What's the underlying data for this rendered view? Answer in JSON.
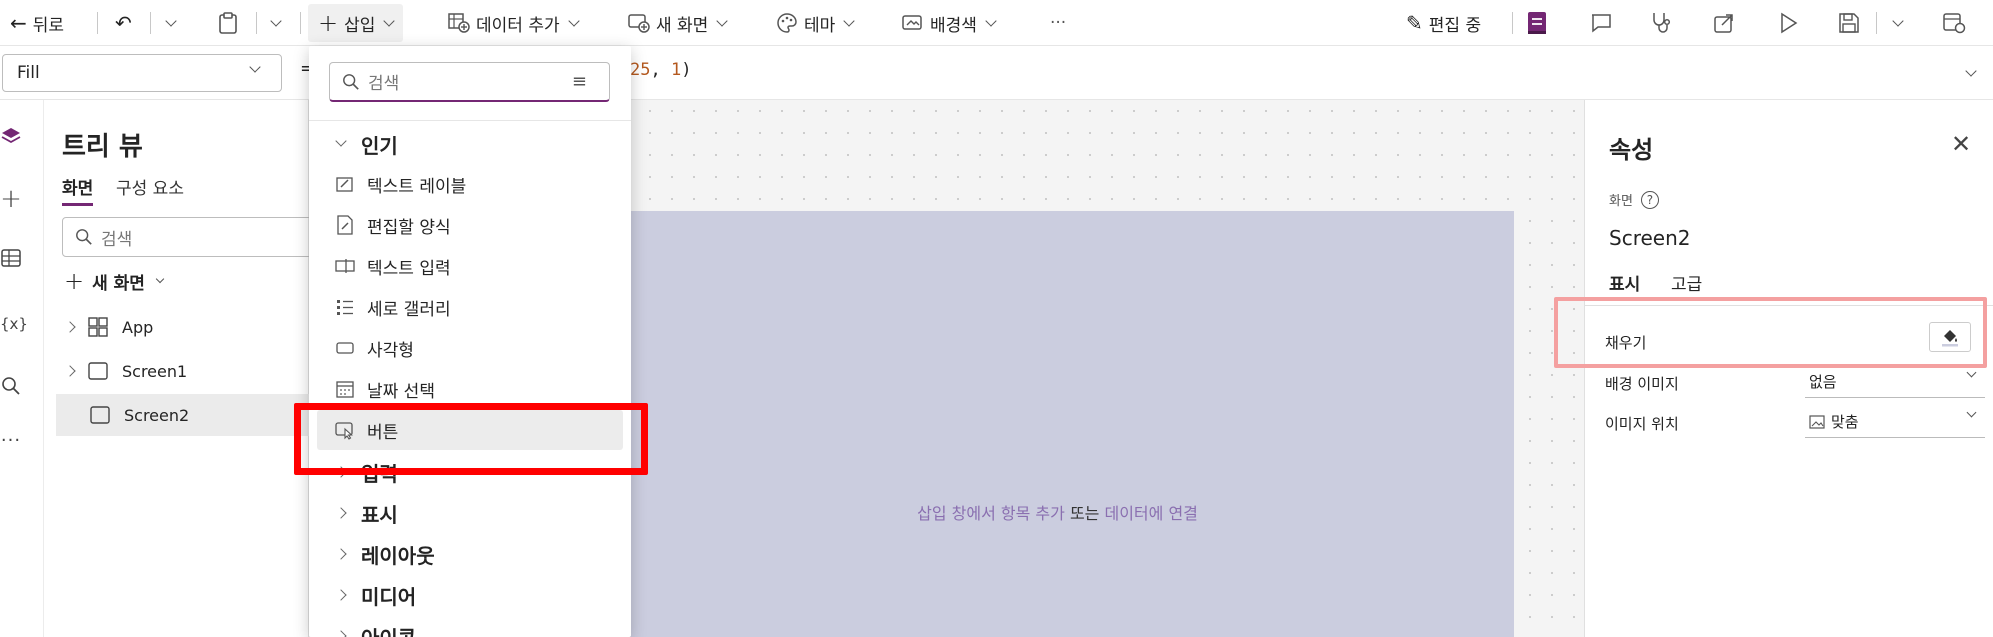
{
  "toolbar": {
    "back_label": "뒤로",
    "insert_label": "삽입",
    "add_data_label": "데이터 추가",
    "new_screen_label": "새 화면",
    "theme_label": "테마",
    "background_label": "배경색",
    "more_label": "···",
    "editing_label": "편집 중"
  },
  "formula": {
    "property": "Fill",
    "equals": "=",
    "tail_num": "25",
    "tail_sep": ", ",
    "tail_num2": "1",
    "tail_close": ")"
  },
  "tree": {
    "title": "트리 뷰",
    "tabs": [
      "화면",
      "구성 요소"
    ],
    "search_placeholder": "검색",
    "new_screen": "새 화면",
    "items": [
      "App",
      "Screen1",
      "Screen2"
    ]
  },
  "insert": {
    "search_placeholder": "검색",
    "popular_label": "인기",
    "items": [
      "텍스트 레이블",
      "편집할 양식",
      "텍스트 입력",
      "세로 갤러리",
      "사각형",
      "날짜 선택",
      "버튼"
    ],
    "categories": [
      "입력",
      "표시",
      "레이아웃",
      "미디어",
      "아이콘"
    ]
  },
  "canvas": {
    "hint_link1": "삽입 창에서 항목 추가",
    "hint_plain": " 또는 ",
    "hint_link2": "데이터에 연결"
  },
  "properties": {
    "title": "속성",
    "scope_label": "화면",
    "screen_name": "Screen2",
    "tabs": [
      "표시",
      "고급"
    ],
    "fill_label": "채우기",
    "bg_image_label": "배경 이미지",
    "bg_image_value": "없음",
    "image_pos_label": "이미지 위치",
    "image_pos_value": "맞춤"
  },
  "colors": {
    "accent": "#742774",
    "screen_fill": "#cbcddf",
    "highlight": "#ff0000"
  }
}
